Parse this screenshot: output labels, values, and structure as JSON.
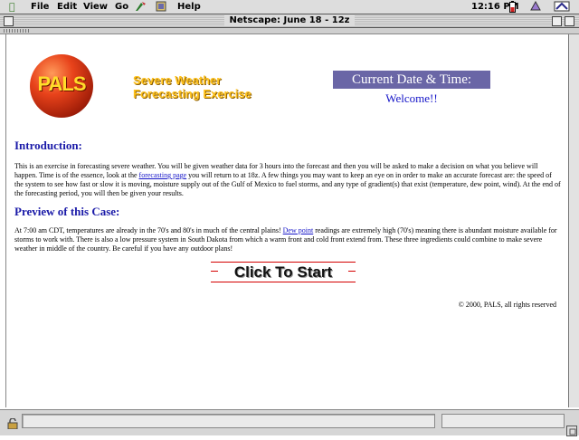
{
  "menubar": {
    "items": [
      "File",
      "Edit",
      "View",
      "Go",
      "Help"
    ],
    "clock": "12:16 PM",
    "icons": [
      "apple-icon",
      "help-icon",
      "book-icon",
      "battery-icon",
      "app-icon",
      "corner-icon"
    ]
  },
  "window": {
    "title": "Netscape: June 18 - 12z"
  },
  "page": {
    "logo_text": "PALS",
    "headline_line1": "Severe Weather",
    "headline_line2": "Forecasting Exercise",
    "datetime_label": "Current Date & Time:",
    "welcome": "Welcome!!",
    "intro_heading": "Introduction:",
    "intro_text_1": "This is an exercise in forecasting severe weather. You will be given weather data for 3 hours into the forecast and then you will be asked to make a decision on what you believe will happen. Time is of the essence, look at the ",
    "intro_link": "forecasting page",
    "intro_text_2": " you will return to at 18z. A few things you may want to keep an eye on in order to make an accurate forecast are: the speed of the system to see how fast or slow it is moving, moisture supply out of the Gulf of Mexico to fuel storms, and any type of gradient(s) that exist (temperature, dew point, wind). At the end of the forecasting period, you will then be given your results.",
    "preview_heading": "Preview of this Case:",
    "preview_text_1": "At 7:00 am CDT, temperatures are already in the 70's and 80's in much of the central plains! ",
    "preview_link": "Dew point",
    "preview_text_2": " readings are extremely high (70's) meaning there is abundant moisture available for storms to work with. There is also a low pressure system in South Dakota from which a warm front and cold front extend from. These three ingredients could combine to make severe weather in middle of the country. Be careful if you have any outdoor plans!",
    "start_button": "Click To Start",
    "copyright": "© 2000, PALS, all rights reserved"
  },
  "colors": {
    "heading": "#1a1aa8",
    "link": "#1515c8",
    "headline": "#ffc21c",
    "datetime_bg": "#6a66a6",
    "button_rule": "#d40000"
  }
}
